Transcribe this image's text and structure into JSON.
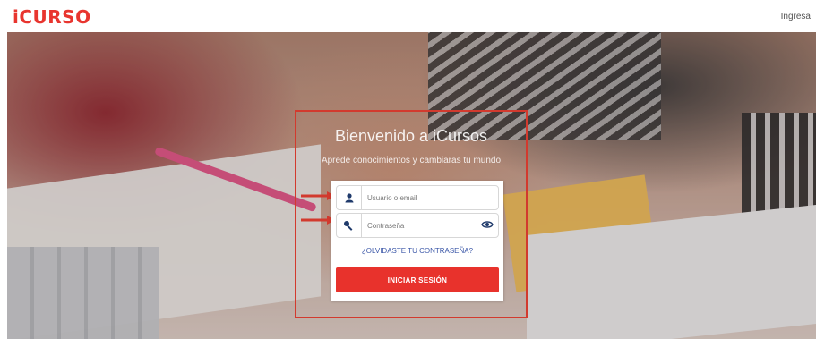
{
  "header": {
    "logo_text": "iCURSO",
    "login_link": "Ingresa"
  },
  "hero": {
    "title": "Bienvenido a iCursos",
    "subtitle": "Aprede conocimientos y cambiaras tu mundo"
  },
  "login_form": {
    "username_placeholder": "Usuario o email",
    "password_placeholder": "Contraseña",
    "forgot_password": "¿OLVIDASTE TU CONTRASEÑA?",
    "submit_label": "INICIAR SESIÓN"
  },
  "icons": {
    "user": "user-icon",
    "key": "key-icon",
    "eye": "eye-icon",
    "arrow": "arrow-right-icon"
  },
  "colors": {
    "brand": "#e8352f",
    "button": "#e8322c",
    "highlight": "#d23a2e",
    "link": "#3b57a8",
    "icon_dark": "#1f3a6b"
  }
}
